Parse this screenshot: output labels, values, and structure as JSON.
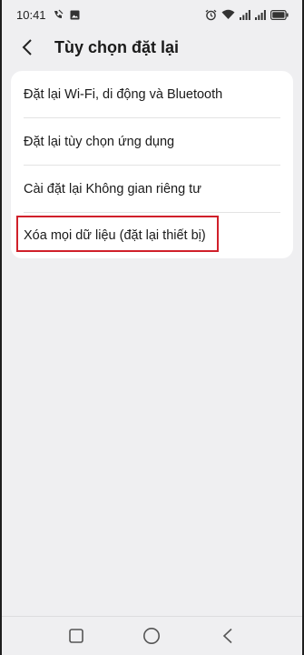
{
  "status_bar": {
    "time": "10:41",
    "left_icons": [
      "call-forward-icon",
      "image-icon"
    ],
    "right_icons": [
      "alarm-icon",
      "wifi-icon",
      "signal-icon",
      "signal-icon",
      "battery-icon"
    ]
  },
  "header": {
    "back_icon": "chevron-left-icon",
    "title": "Tùy chọn đặt lại"
  },
  "reset_options": [
    {
      "label": "Đặt lại Wi-Fi, di động và Bluetooth"
    },
    {
      "label": "Đặt lại tùy chọn ứng dụng"
    },
    {
      "label": "Cài đặt lại Không gian riêng tư"
    },
    {
      "label": "Xóa mọi dữ liệu (đặt lại thiết bị)",
      "highlighted": true
    }
  ],
  "colors": {
    "background": "#efeff1",
    "card": "#ffffff",
    "highlight_border": "#d0202a",
    "text": "#1a1a1a"
  },
  "nav_bar": {
    "items": [
      "recents-square-icon",
      "home-circle-icon",
      "back-triangle-icon"
    ]
  }
}
